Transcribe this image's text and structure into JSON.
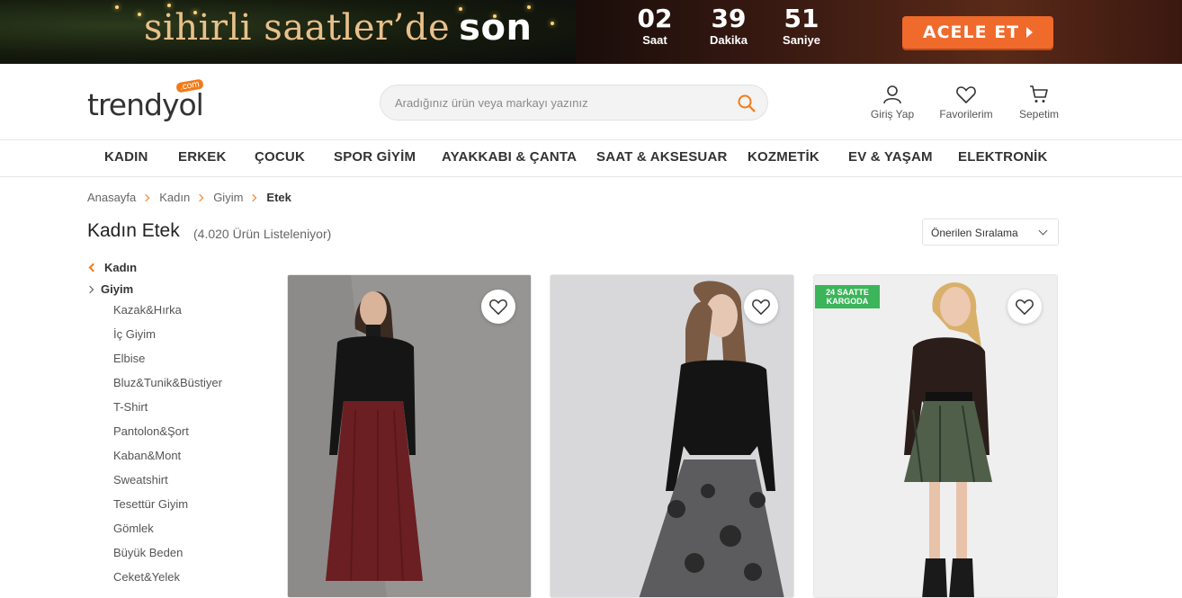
{
  "banner": {
    "title_script": "sihirli saatler’de",
    "title_bold": "son",
    "timer": [
      {
        "value": "02",
        "label": "Saat"
      },
      {
        "value": "39",
        "label": "Dakika"
      },
      {
        "value": "51",
        "label": "Saniye"
      }
    ],
    "cta_label": "ACELE ET"
  },
  "header": {
    "logo_text": "trendyol",
    "logo_badge": ".com",
    "search_placeholder": "Aradığınız ürün veya markayı yazınız",
    "actions": {
      "login": "Giriş Yap",
      "favorites": "Favorilerim",
      "cart": "Sepetim"
    }
  },
  "nav": [
    "KADIN",
    "ERKEK",
    "ÇOCUK",
    "SPOR GİYİM",
    "AYAKKABI & ÇANTA",
    "SAAT & AKSESUAR",
    "KOZMETİK",
    "EV & YAŞAM",
    "ELEKTRONİK"
  ],
  "breadcrumb": [
    "Anasayfa",
    "Kadın",
    "Giyim",
    "Etek"
  ],
  "page": {
    "title": "Kadın Etek",
    "count": "(4.020 Ürün Listeleniyor)",
    "sort_label": "Önerilen Sıralama"
  },
  "sidebar": {
    "parent": "Kadın",
    "current": "Giyim",
    "items": [
      "Kazak&Hırka",
      "İç Giyim",
      "Elbise",
      "Bluz&Tunik&Büstiyer",
      "T-Shirt",
      "Pantolon&Şort",
      "Kaban&Mont",
      "Sweatshirt",
      "Tesettür Giyim",
      "Gömlek",
      "Büyük Beden",
      "Ceket&Yelek"
    ]
  },
  "products": [
    {
      "badge": ""
    },
    {
      "badge": ""
    },
    {
      "badge": "24 SAATTE KARGODA"
    }
  ],
  "colors": {
    "brand_orange": "#f27a1a",
    "cta_orange": "#f06a2c",
    "badge_green": "#3cb55a"
  }
}
